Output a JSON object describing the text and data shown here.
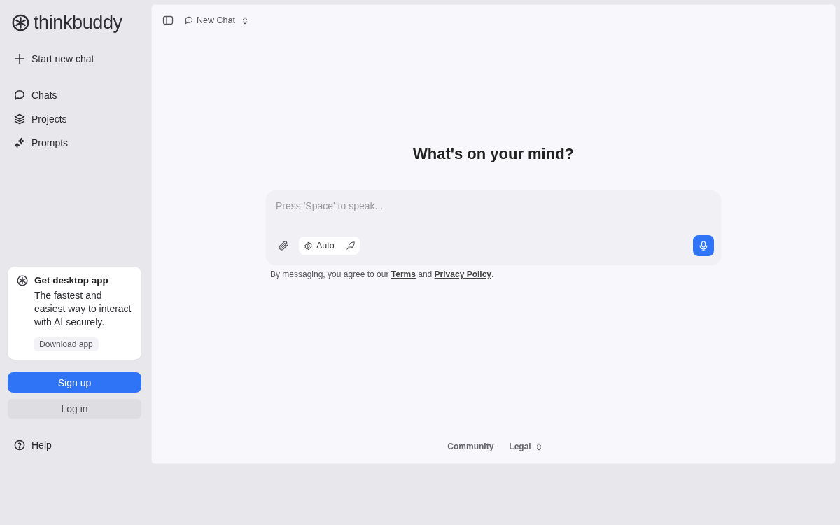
{
  "sidebar": {
    "brand": "thinkbuddy",
    "new_chat": "Start new chat",
    "nav": [
      "Chats",
      "Projects",
      "Prompts"
    ],
    "promo": {
      "title": "Get desktop app",
      "text": "The fastest and easiest way to interact with AI securely.",
      "button": "Download app"
    },
    "signup": "Sign up",
    "login": "Log in",
    "help": "Help"
  },
  "topbar": {
    "chat_title": "New Chat"
  },
  "main": {
    "heading": "What's on your mind?",
    "composer": {
      "placeholder": "Press 'Space' to speak...",
      "model": "Auto"
    },
    "consent": {
      "lead": "By messaging, you agree to our",
      "links": [
        "Terms",
        "Privacy Policy"
      ],
      "joiner": "and",
      "tail": "."
    }
  },
  "footer": {
    "community": "Community",
    "legal": "Legal"
  }
}
